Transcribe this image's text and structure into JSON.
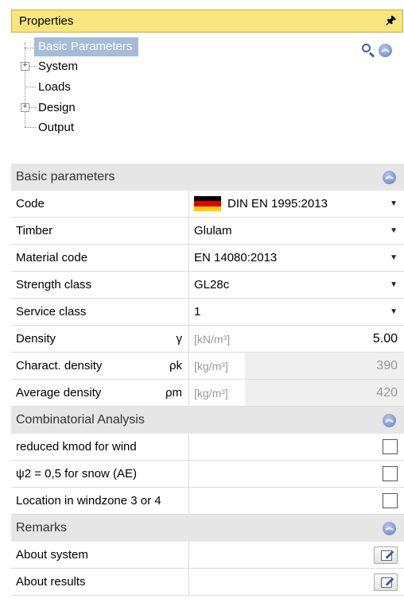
{
  "panel": {
    "title": "Properties",
    "pin_icon": "pin-icon"
  },
  "tree": {
    "items": [
      {
        "label": "Basic Parameters",
        "selected": true,
        "expandable": false
      },
      {
        "label": "System",
        "expandable": true
      },
      {
        "label": "Loads",
        "expandable": false
      },
      {
        "label": "Design",
        "expandable": true
      },
      {
        "label": "Output",
        "expandable": false
      }
    ]
  },
  "toolbar_icons": [
    "search-icon",
    "collapse-all-icon"
  ],
  "sections": {
    "basic": {
      "title": "Basic parameters",
      "rows": {
        "code": {
          "label": "Code",
          "value": "DIN EN 1995:2013"
        },
        "timber": {
          "label": "Timber",
          "value": "Glulam"
        },
        "material_code": {
          "label": "Material code",
          "value": "EN 14080:2013"
        },
        "strength_class": {
          "label": "Strength class",
          "value": "GL28c"
        },
        "service_class": {
          "label": "Service class",
          "value": "1"
        },
        "density": {
          "label": "Density",
          "symbol": "γ",
          "unit": "[kN/m³]",
          "value": "5.00"
        },
        "charact_density": {
          "label": "Charact. density",
          "symbol": "ρk",
          "unit": "[kg/m³]",
          "value": "390"
        },
        "average_density": {
          "label": "Average density",
          "symbol": "ρm",
          "unit": "[kg/m³]",
          "value": "420"
        }
      }
    },
    "combinatorial": {
      "title": "Combinatorial Analysis",
      "rows": {
        "kmod_wind": {
          "label": "reduced kmod for wind",
          "checked": false
        },
        "psi2_snow": {
          "label": "ψ2 = 0,5 for snow (AE)",
          "checked": false
        },
        "windzone": {
          "label": "Location in windzone 3 or 4",
          "checked": false
        }
      }
    },
    "remarks": {
      "title": "Remarks",
      "rows": {
        "about_system": {
          "label": "About system"
        },
        "about_results": {
          "label": "About results"
        }
      }
    }
  },
  "colors": {
    "header_bg": "#f8e580",
    "selected_bg": "#a6bbd8",
    "section_bg": "#e6e6e6"
  }
}
